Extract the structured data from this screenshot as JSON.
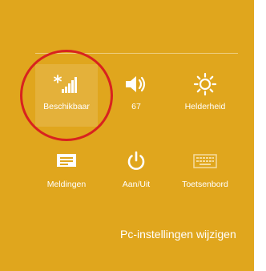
{
  "quick_settings": {
    "network": {
      "label": "Beschikbaar",
      "icon": "network-signal-available-icon"
    },
    "volume": {
      "label": "67",
      "icon": "speaker-icon"
    },
    "brightness": {
      "label": "Helderheid",
      "icon": "brightness-sun-icon"
    },
    "notifications": {
      "label": "Meldingen",
      "icon": "notifications-icon"
    },
    "power": {
      "label": "Aan/Uit",
      "icon": "power-icon"
    },
    "keyboard": {
      "label": "Toetsenbord",
      "icon": "keyboard-icon"
    }
  },
  "footer": {
    "pc_settings_link": "Pc-instellingen wijzigen"
  },
  "colors": {
    "panel_background": "#e0a61d",
    "highlight_circle": "#d8231f",
    "text": "#ffffff"
  }
}
